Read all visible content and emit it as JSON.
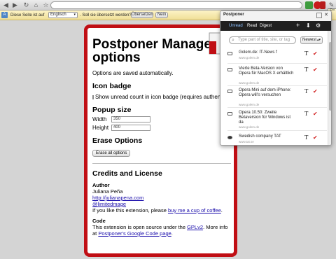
{
  "browser": {
    "tooltip": "Re"
  },
  "translate_bar": {
    "text_before": "Diese Seite ist auf",
    "language": "Englisch",
    "text_after": ". Soll sie übersetzt werden?",
    "translate_label": "Übersetzen",
    "no_label": "Nein"
  },
  "options_page": {
    "title": "Postponer Manager options",
    "saved_note": "Options are saved automatically.",
    "icon_badge": {
      "heading": "Icon badge",
      "checkbox_label": "Show unread count in icon badge (requires authentication)"
    },
    "popup_size": {
      "heading": "Popup size",
      "width_label": "Width",
      "width_value": "350",
      "height_label": "Height",
      "height_value": "400"
    },
    "erase": {
      "heading": "Erase Options",
      "button": "Erase all options"
    },
    "credits": {
      "heading": "Credits and License",
      "author_heading": "Author",
      "author_name": "Juliana Peña",
      "link_site": "http://julianapena.com",
      "link_twitter": "@limitedmage",
      "donate_before": "If you like this extension, please",
      "donate_link": "buy me a cup of coffee",
      "donate_after": ".",
      "code_heading": "Code",
      "code_before": "This extension is open source under the",
      "code_license": "GPLv2",
      "code_after": ". More info at",
      "code_link": "Postponer's Google Code page",
      "code_end": "."
    }
  },
  "popup": {
    "title": "Postponer",
    "tabs": [
      "Unread",
      "Read",
      "Digest"
    ],
    "active_tab": "Unread",
    "search_placeholder": "Type part of title, site, or tag",
    "sort_value": "Newest",
    "items": [
      {
        "title": "Golem.de: IT-News f",
        "source": "www.golem.de"
      },
      {
        "title": "Vierte Beta-Version von Opera für MacOS X erhältlich",
        "source": "www.golem.de"
      },
      {
        "title": "Opera Mini auf dem iPhone: Opera will's versuchen",
        "source": "www.golem.de"
      },
      {
        "title": "Opera 10.50: Zweite Betaversion für Windows ist da",
        "source": "www.golem.de"
      },
      {
        "title": "Swedish company TAT",
        "source": "www.tat.se"
      }
    ]
  }
}
